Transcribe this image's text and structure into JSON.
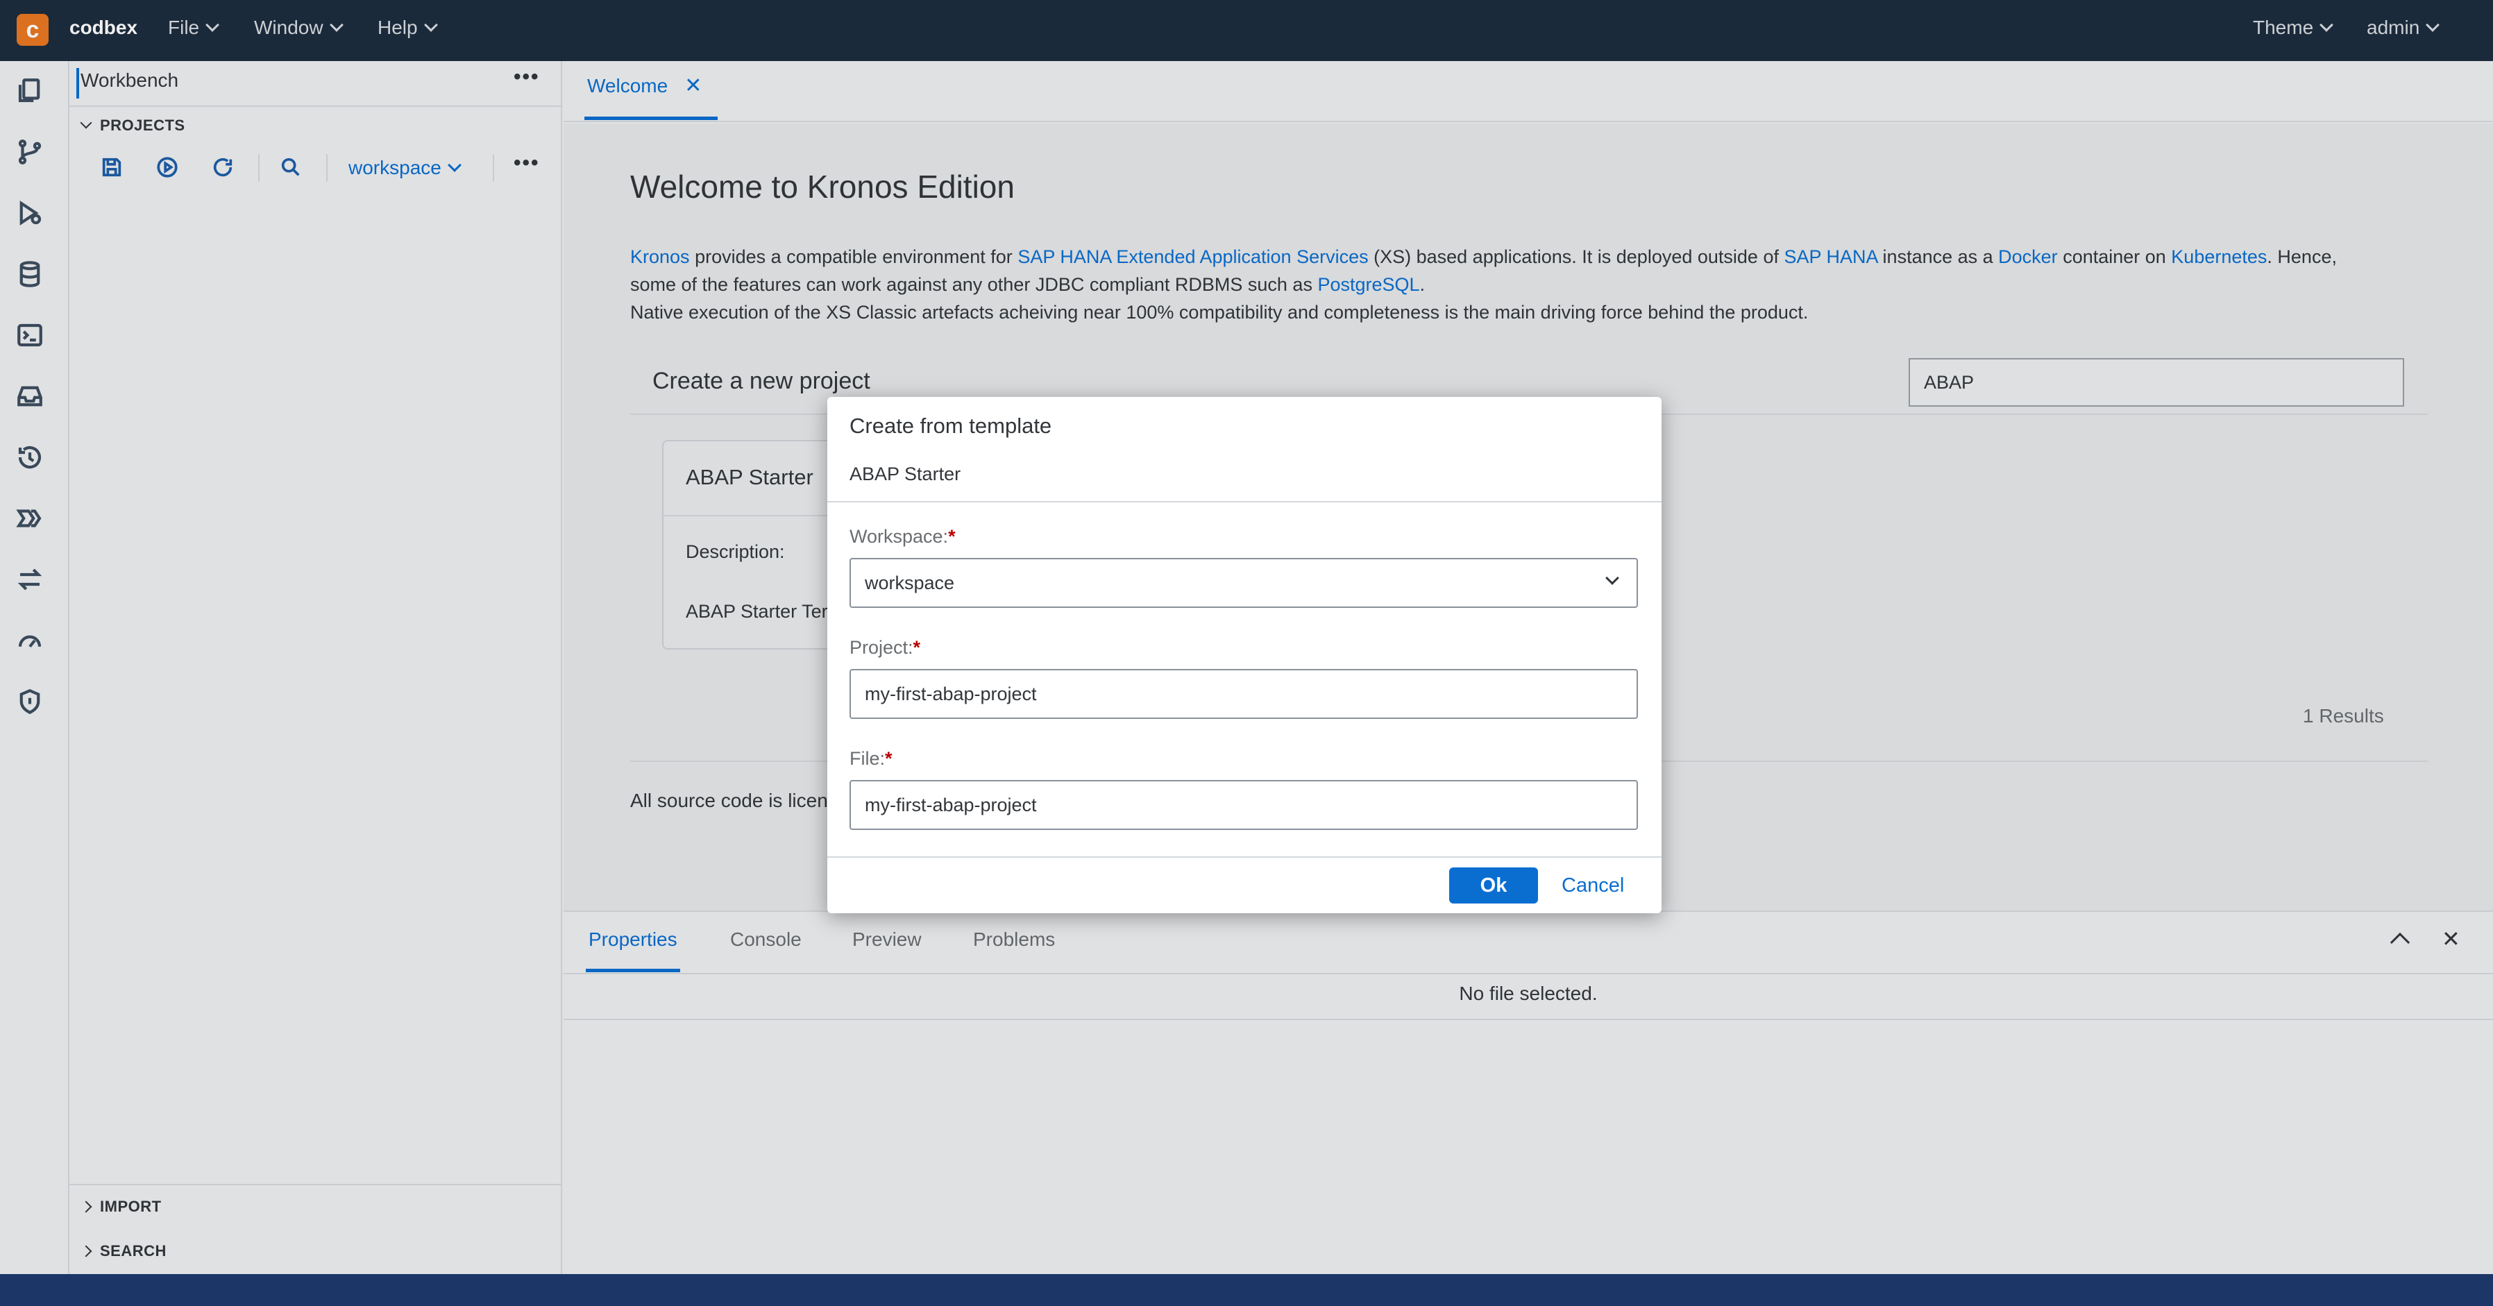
{
  "topbar": {
    "brand": "codbex",
    "menus": [
      "File",
      "Window",
      "Help"
    ],
    "theme_label": "Theme",
    "user_label": "admin"
  },
  "activity_icons": [
    "projects-icon",
    "git-icon",
    "debug-icon",
    "database-icon",
    "terminal-icon",
    "inbox-icon",
    "history-icon",
    "pipeline-icon",
    "transfer-icon",
    "dashboard-icon",
    "security-icon"
  ],
  "explorer": {
    "title": "Workbench",
    "projects_header": "PROJECTS",
    "workspace_select": "workspace",
    "import_header": "IMPORT",
    "search_header": "SEARCH"
  },
  "editor": {
    "tab_label": "Welcome",
    "welcome_title": "Welcome to Kronos Edition",
    "para1": {
      "link_kronos": "Kronos",
      "t1": " provides a compatible environment for ",
      "link_xs": "SAP HANA Extended Application Services",
      "t2": " (XS) based applications. It is deployed outside of ",
      "link_hana": "SAP HANA",
      "t3": " instance as a ",
      "link_docker": "Docker",
      "t4": " container on ",
      "link_k8s": "Kubernetes",
      "t5": ". Hence,"
    },
    "para2": {
      "t1": "some of the features can work against any other JDBC compliant RDBMS such as ",
      "link_pg": "PostgreSQL",
      "t2": "."
    },
    "para3": "Native execution of the XS Classic artefacts acheiving near 100% compatibility and completeness is the main driving force behind the product.",
    "create_project_title": "Create a new project",
    "search_value": "ABAP",
    "template_card": {
      "title": "ABAP Starter",
      "description_label": "Description:",
      "description_text": "ABAP Starter Ter"
    },
    "results_count": "1 Results",
    "license_text": "All source code is licen"
  },
  "bottom_panel": {
    "tabs": [
      "Properties",
      "Console",
      "Preview",
      "Problems"
    ],
    "empty_message": "No file selected."
  },
  "modal": {
    "title": "Create from template",
    "subtitle": "ABAP Starter",
    "workspace_label": "Workspace:",
    "workspace_value": "workspace",
    "project_label": "Project:",
    "project_value": "my-first-abap-project",
    "file_label": "File:",
    "file_value": "my-first-abap-project",
    "ok_label": "Ok",
    "cancel_label": "Cancel"
  },
  "colors": {
    "topbar_bg": "#1d2d3e",
    "accent": "#0a6ed1",
    "statusbar": "#1e3a6e",
    "required": "#bb0000",
    "logo": "#e87722"
  }
}
